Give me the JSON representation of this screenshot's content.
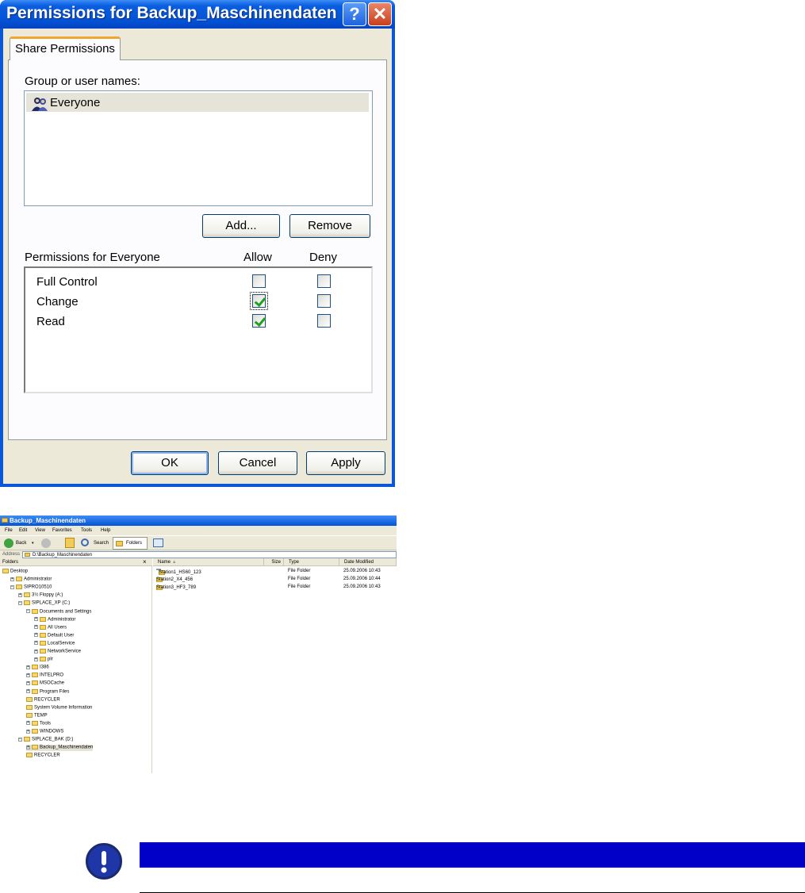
{
  "dialog": {
    "title": "Permissions for Backup_Maschinendaten",
    "help_glyph": "?",
    "close_glyph": "✕",
    "tab": "Share Permissions",
    "group_label": "Group or user names:",
    "users": [
      {
        "name": "Everyone",
        "icon": "users-group-icon",
        "selected": true
      }
    ],
    "add_button": "Add...",
    "remove_button": "Remove",
    "permissions_label": "Permissions for Everyone",
    "allow_header": "Allow",
    "deny_header": "Deny",
    "permissions": [
      {
        "name": "Full Control",
        "allow": false,
        "deny": false
      },
      {
        "name": "Change",
        "allow": true,
        "deny": false
      },
      {
        "name": "Read",
        "allow": true,
        "deny": false
      }
    ],
    "ok_button": "OK",
    "cancel_button": "Cancel",
    "apply_button": "Apply"
  },
  "explorer": {
    "title": "Backup_Maschinendaten",
    "menu": [
      "File",
      "Edit",
      "View",
      "Favorites",
      "Tools",
      "Help"
    ],
    "toolbar": {
      "back": "Back",
      "search": "Search",
      "folders": "Folders"
    },
    "address_label": "Address",
    "address_value": "D:\\Backup_Maschinendaten",
    "folders_header": "Folders",
    "folders_close": "×",
    "tree": [
      {
        "label": "Desktop",
        "level": 0,
        "expander": ""
      },
      {
        "label": "Administrator",
        "level": 1,
        "expander": "+"
      },
      {
        "label": "SIPRO10510",
        "level": 1,
        "expander": "−"
      },
      {
        "label": "3½ Floppy (A:)",
        "level": 2,
        "expander": "+"
      },
      {
        "label": "SIPLACE_XP (C:)",
        "level": 2,
        "expander": "−"
      },
      {
        "label": "Documents and Settings",
        "level": 3,
        "expander": "−"
      },
      {
        "label": "Administrator",
        "level": 4,
        "expander": "+"
      },
      {
        "label": "All Users",
        "level": 4,
        "expander": "+"
      },
      {
        "label": "Default User",
        "level": 4,
        "expander": "+"
      },
      {
        "label": "LocalService",
        "level": 4,
        "expander": "+"
      },
      {
        "label": "NetworkService",
        "level": 4,
        "expander": "+"
      },
      {
        "label": "plr",
        "level": 4,
        "expander": "+"
      },
      {
        "label": "I386",
        "level": 3,
        "expander": "+"
      },
      {
        "label": "INTELPRO",
        "level": 3,
        "expander": "+"
      },
      {
        "label": "MSOCache",
        "level": 3,
        "expander": "+"
      },
      {
        "label": "Program Files",
        "level": 3,
        "expander": "+"
      },
      {
        "label": "RECYCLER",
        "level": 3,
        "expander": ""
      },
      {
        "label": "System Volume Information",
        "level": 3,
        "expander": ""
      },
      {
        "label": "TEMP",
        "level": 3,
        "expander": ""
      },
      {
        "label": "Tools",
        "level": 3,
        "expander": "+"
      },
      {
        "label": "WINDOWS",
        "level": 3,
        "expander": "+"
      },
      {
        "label": "SIPLACE_BAK (D:)",
        "level": 2,
        "expander": "−"
      },
      {
        "label": "Backup_Maschinendaten",
        "level": 3,
        "expander": "+"
      },
      {
        "label": "RECYCLER",
        "level": 3,
        "expander": ""
      }
    ],
    "columns": {
      "name": "Name",
      "size": "Size",
      "type": "Type",
      "date": "Date Modified"
    },
    "files": [
      {
        "name": "Station1_HS60_123",
        "size": "",
        "type": "File Folder",
        "date": "25.09.2006 10:43"
      },
      {
        "name": "Station2_X4_456",
        "size": "",
        "type": "File Folder",
        "date": "25.09.2006 10:44"
      },
      {
        "name": "Station3_HF3_789",
        "size": "",
        "type": "File Folder",
        "date": "25.09.2006 10:43"
      }
    ]
  },
  "colors": {
    "title_bar": "#0453d6",
    "dialog_face": "#ece9d8",
    "notice_bar": "#0000c8",
    "notice_icon": "#1f36a8"
  }
}
